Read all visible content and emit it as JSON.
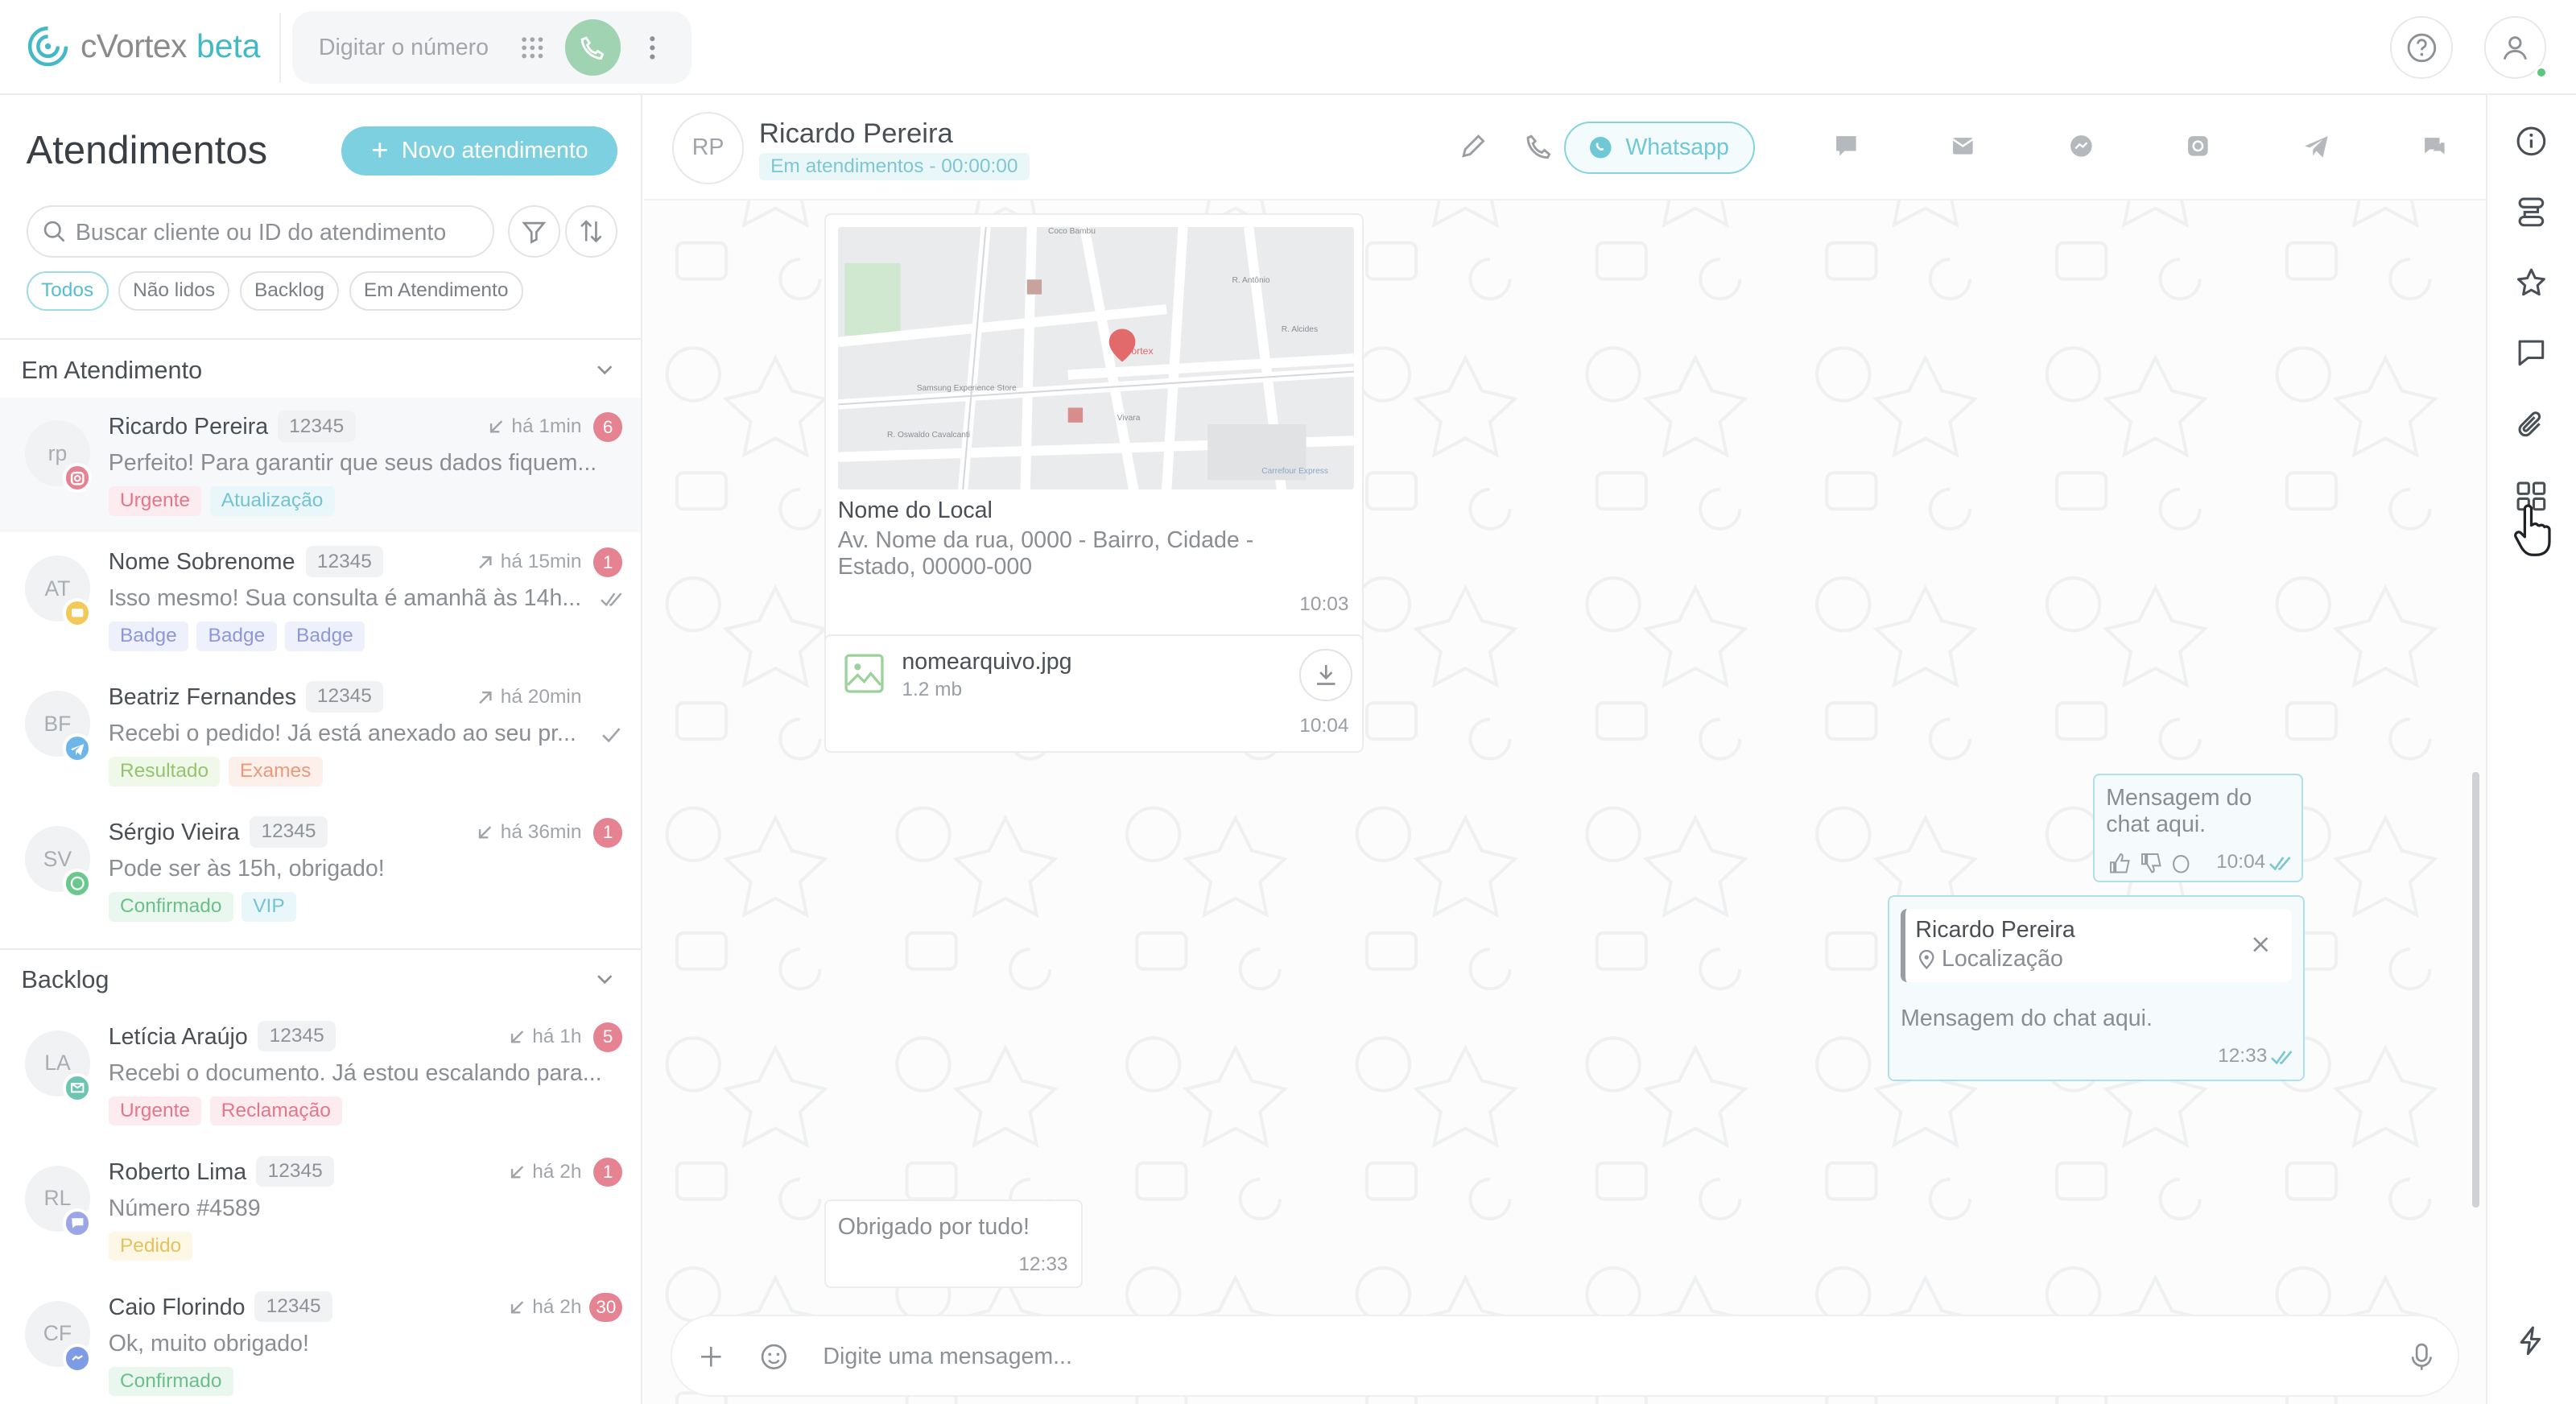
{
  "app": {
    "logo_name": "cVortex",
    "logo_beta": "beta",
    "brand_color": "#43b9c7"
  },
  "dialer": {
    "placeholder": "Digitar o número"
  },
  "left": {
    "title": "Atendimentos",
    "new_button": "Novo atendimento",
    "search_placeholder": "Buscar cliente ou ID do atendimento",
    "filters": [
      "Todos",
      "Não lidos",
      "Backlog",
      "Em Atendimento"
    ],
    "active_filter": "Todos",
    "sections": [
      {
        "title": "Em Atendimento",
        "items": [
          {
            "initials": "rp",
            "name": "Ricardo Pereira",
            "id": "12345",
            "direction": "in",
            "time": "há 1min",
            "unread": "6",
            "message": "Perfeito! Para garantir que seus dados fiquem...",
            "check": "",
            "channel": "instagram",
            "tags": [
              {
                "label": "Urgente",
                "bg": "#fdecef",
                "fg": "#e4768a"
              },
              {
                "label": "Atualização",
                "bg": "#e9f6fa",
                "fg": "#73c3d5"
              }
            ]
          },
          {
            "initials": "AT",
            "name": "Nome Sobrenome",
            "id": "12345",
            "direction": "out",
            "time": "há 15min",
            "unread": "1",
            "message": "Isso mesmo! Sua consulta é amanhã às 14h...",
            "check": "double",
            "channel": "chat",
            "tags": [
              {
                "label": "Badge",
                "bg": "#eef0fb",
                "fg": "#8e98d8"
              },
              {
                "label": "Badge",
                "bg": "#eef0fb",
                "fg": "#8e98d8"
              },
              {
                "label": "Badge",
                "bg": "#eef0fb",
                "fg": "#8e98d8"
              }
            ]
          },
          {
            "initials": "BF",
            "name": "Beatriz Fernandes",
            "id": "12345",
            "direction": "out",
            "time": "há 20min",
            "unread": "",
            "message": "Recebi o pedido! Já está anexado ao seu pr...",
            "check": "single",
            "channel": "telegram",
            "tags": [
              {
                "label": "Resultado",
                "bg": "#f0f8e9",
                "fg": "#95c46e"
              },
              {
                "label": "Exames",
                "bg": "#fdf0ea",
                "fg": "#e99a7c"
              }
            ]
          },
          {
            "initials": "SV",
            "name": "Sérgio Vieira",
            "id": "12345",
            "direction": "in",
            "time": "há 36min",
            "unread": "1",
            "message": "Pode ser às 15h, obrigado!",
            "check": "",
            "channel": "whatsapp",
            "tags": [
              {
                "label": "Confirmado",
                "bg": "#eaf7ef",
                "fg": "#6bbf8a"
              },
              {
                "label": "VIP",
                "bg": "#e9f6fa",
                "fg": "#73c3d5"
              }
            ]
          }
        ]
      },
      {
        "title": "Backlog",
        "items": [
          {
            "initials": "LA",
            "name": "Letícia Araújo",
            "id": "12345",
            "direction": "in",
            "time": "há 1h",
            "unread": "5",
            "message": "Recebi o documento. Já estou escalando para...",
            "check": "",
            "channel": "email",
            "tags": [
              {
                "label": "Urgente",
                "bg": "#fdecef",
                "fg": "#e4768a"
              },
              {
                "label": "Reclamação",
                "bg": "#fdecef",
                "fg": "#e4768a"
              }
            ]
          },
          {
            "initials": "RL",
            "name": "Roberto Lima",
            "id": "12345",
            "direction": "in",
            "time": "há 2h",
            "unread": "1",
            "message": "Número #4589",
            "check": "",
            "channel": "webchat",
            "tags": [
              {
                "label": "Pedido",
                "bg": "#fdf7e6",
                "fg": "#e6c25c"
              }
            ]
          },
          {
            "initials": "CF",
            "name": "Caio Florindo",
            "id": "12345",
            "direction": "in",
            "time": "há 2h",
            "unread": "30",
            "message": "Ok, muito obrigado!",
            "check": "",
            "channel": "messenger",
            "tags": [
              {
                "label": "Confirmado",
                "bg": "#eaf7ef",
                "fg": "#6bbf8a"
              }
            ]
          }
        ]
      }
    ]
  },
  "chat": {
    "initials": "RP",
    "name": "Ricardo Pereira",
    "status": "Em atendimentos - 00:00:00",
    "channel_button": "Whatsapp",
    "header_icons": [
      "edit-icon",
      "phone-icon",
      "whatsapp-icon",
      "chat-icon",
      "mail-icon",
      "messenger-icon",
      "instagram-icon",
      "telegram-icon",
      "webchat-icon"
    ],
    "messages": {
      "location": {
        "map_labels": [
          "Coco Bambu",
          "cVortex",
          "Samsung Experience Store",
          "Vivara",
          "Carrefour Express",
          "R. Oswaldo Cavalcanti",
          "R. Alcides",
          "R. Antônio"
        ],
        "title": "Nome do Local",
        "address": "Av. Nome da rua, 0000 - Bairro, Cidade - Estado, 00000-000",
        "time": "10:03"
      },
      "file": {
        "name": "nomearquivo.jpg",
        "size": "1.2 mb",
        "time": "10:04"
      },
      "outgoing1": {
        "text": "Mensagem do chat aqui.",
        "time": "10:04"
      },
      "outgoing2": {
        "reply_name": "Ricardo Pereira",
        "reply_text": "Localização",
        "text": "Mensagem do chat aqui.",
        "time": "12:33"
      },
      "incoming": {
        "text": "Obrigado por tudo!",
        "time": "12:33"
      }
    },
    "composer_placeholder": "Digite uma mensagem..."
  },
  "rail": {
    "icons": [
      "info-icon",
      "flow-icon",
      "star-icon",
      "comment-icon",
      "paperclip-icon",
      "apps-icon",
      "bolt-icon"
    ]
  }
}
